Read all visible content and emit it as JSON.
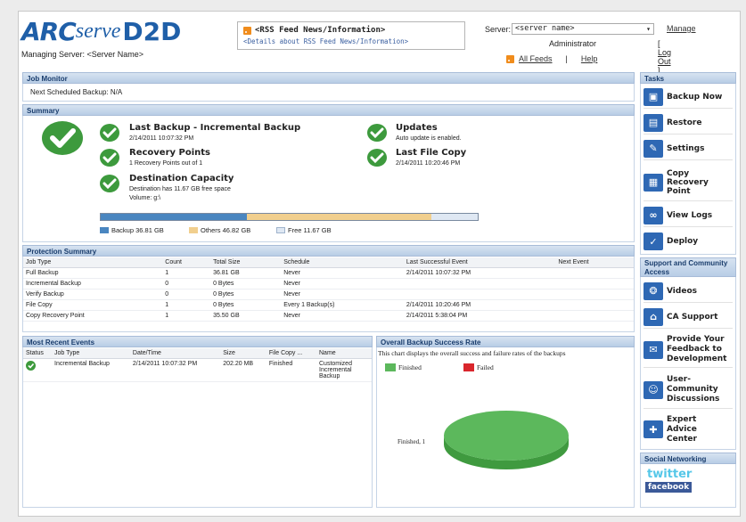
{
  "header": {
    "logo": {
      "arc": "ARC",
      "serve": "serve",
      "d2d": "D2D"
    },
    "managing_server": "Managing Server: <Server Name>",
    "rss_title": "<RSS Feed News/Information>",
    "rss_sub": "<Details about RSS Feed News/Information>",
    "server_label": "Server:",
    "server_value": "<server name>",
    "manage_link": "Manage",
    "admin_name": "Administrator",
    "logout_link": "[ Log Out ]",
    "all_feeds": "All Feeds",
    "separator": "|",
    "help": "Help"
  },
  "job_monitor": {
    "title": "Job Monitor",
    "next_backup": "Next Scheduled Backup: N/A"
  },
  "summary": {
    "title": "Summary",
    "last_backup_title": "Last Backup - Incremental Backup",
    "last_backup_time": "2/14/2011 10:07:32 PM",
    "recovery_points_title": "Recovery Points",
    "recovery_points_sub": "1 Recovery Points out of 1",
    "dest_capacity_title": "Destination Capacity",
    "dest_capacity_sub": "Destination has 11.67 GB free space",
    "volume": "Volume: g:\\",
    "updates_title": "Updates",
    "updates_sub": "Auto update is enabled.",
    "last_file_copy_title": "Last File Copy",
    "last_file_copy_time": "2/14/2011 10:20:46 PM",
    "capacity": {
      "backup_label": "Backup 36.81 GB",
      "others_label": "Others 46.82 GB",
      "free_label": "Free 11.67 GB",
      "backup_fraction": 0.387,
      "others_fraction": 0.49,
      "free_fraction": 0.123,
      "backup_color": "#4a86c0",
      "others_color": "#f1cf8e",
      "free_color": "#dfe8f3"
    }
  },
  "protection_summary": {
    "title": "Protection Summary",
    "columns": [
      "Job Type",
      "Count",
      "Total Size",
      "Schedule",
      "Last Successful Event",
      "Next Event"
    ],
    "rows": [
      [
        "Full Backup",
        "1",
        "36.81 GB",
        "Never",
        "2/14/2011 10:07:32 PM",
        ""
      ],
      [
        "Incremental Backup",
        "0",
        "0 Bytes",
        "Never",
        "",
        ""
      ],
      [
        "Verify Backup",
        "0",
        "0 Bytes",
        "Never",
        "",
        ""
      ],
      [
        "File Copy",
        "1",
        "0 Bytes",
        "Every 1 Backup(s)",
        "2/14/2011 10:20:46 PM",
        ""
      ],
      [
        "Copy Recovery Point",
        "1",
        "35.50 GB",
        "Never",
        "2/14/2011 5:38:04 PM",
        ""
      ]
    ]
  },
  "recent_events": {
    "title": "Most Recent Events",
    "columns": [
      "Status",
      "Job Type",
      "Date/Time",
      "Size",
      "File Copy ...",
      "Name"
    ],
    "rows": [
      {
        "job_type": "Incremental Backup",
        "datetime": "2/14/2011 10:07:32 PM",
        "size": "202.20 MB",
        "file_copy": "Finished",
        "name": "Customized Incremental Backup"
      }
    ]
  },
  "success_rate": {
    "title": "Overall Backup Success Rate",
    "description": "This chart displays the overall success and failure rates of the backups",
    "legend_finished": "Finished",
    "legend_failed": "Failed",
    "finished_color": "#5cb85c",
    "failed_color": "#d9262c",
    "pie_label": "Finished, 1"
  },
  "chart_data": {
    "type": "pie",
    "categories": [
      "Finished",
      "Failed"
    ],
    "values": [
      1,
      0
    ],
    "title": "Overall Backup Success Rate"
  },
  "tasks": {
    "title": "Tasks",
    "items": [
      "Backup Now",
      "Restore",
      "Settings",
      "Copy Recovery Point",
      "View Logs",
      "Deploy"
    ]
  },
  "support": {
    "title": "Support and Community Access",
    "items": [
      "Videos",
      "CA Support",
      "Provide Your Feedback to Development",
      "User-Community Discussions",
      "Expert Advice Center"
    ]
  },
  "social": {
    "title": "Social Networking",
    "twitter": "twitter",
    "facebook": "facebook"
  }
}
